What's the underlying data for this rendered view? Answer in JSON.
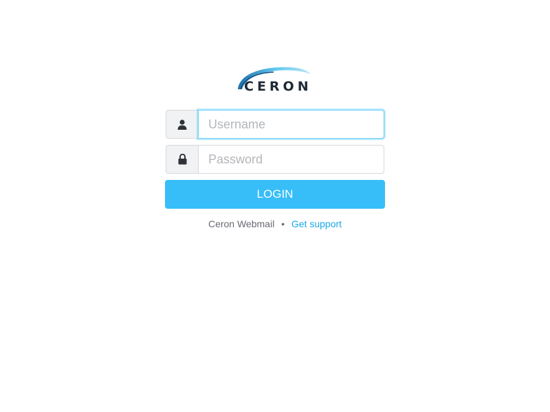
{
  "logo": {
    "text": "CERON",
    "icon": "ceron-logo"
  },
  "login_form": {
    "username": {
      "value": "",
      "placeholder": "Username",
      "icon": "user-icon"
    },
    "password": {
      "value": "",
      "placeholder": "Password",
      "icon": "lock-icon"
    },
    "login_label": "LOGIN"
  },
  "footer": {
    "product_name": "Ceron Webmail",
    "separator": "•",
    "support_link": "Get support"
  },
  "colors": {
    "accent": "#37bef9",
    "link": "#1aa7e8",
    "addon_bg": "#f0f2f4",
    "border": "#d5d8dc"
  }
}
